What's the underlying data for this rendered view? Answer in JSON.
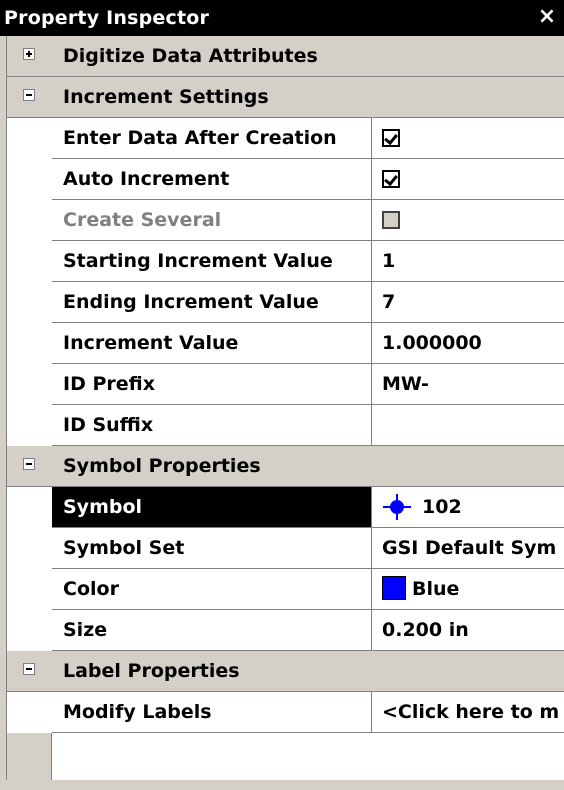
{
  "panel": {
    "title": "Property Inspector",
    "close_label": "×"
  },
  "categories": {
    "digitize": "Digitize Data Attributes",
    "increment": "Increment Settings",
    "symbol": "Symbol Properties",
    "label": "Label Properties"
  },
  "increment": {
    "enter_data_after_creation": {
      "name": "Enter Data After Creation",
      "checked": true
    },
    "auto_increment": {
      "name": "Auto Increment",
      "checked": true
    },
    "create_several": {
      "name": "Create Several",
      "checked": false,
      "disabled": true
    },
    "starting_value": {
      "name": "Starting Increment Value",
      "value": "1"
    },
    "ending_value": {
      "name": "Ending Increment Value",
      "value": "7"
    },
    "increment_value": {
      "name": "Increment Value",
      "value": "1.000000"
    },
    "id_prefix": {
      "name": "ID Prefix",
      "value": "MW-"
    },
    "id_suffix": {
      "name": "ID Suffix",
      "value": ""
    }
  },
  "symbol": {
    "symbol": {
      "name": "Symbol",
      "value": "102",
      "icon": "crosshair-dot-icon",
      "icon_color": "#0000ff"
    },
    "symbol_set": {
      "name": "Symbol Set",
      "value": "GSI Default Sym"
    },
    "color": {
      "name": "Color",
      "value": "Blue",
      "swatch": "#0000ff"
    },
    "size": {
      "name": "Size",
      "value": "0.200 in"
    }
  },
  "labels": {
    "modify_labels": {
      "name": "Modify Labels",
      "value": "<Click here to m"
    }
  },
  "colors": {
    "chrome": "#d4d0c8",
    "titlebar": "#000000",
    "selected_row": "#000000",
    "disabled_text": "#808080",
    "grid_line": "#808080"
  }
}
